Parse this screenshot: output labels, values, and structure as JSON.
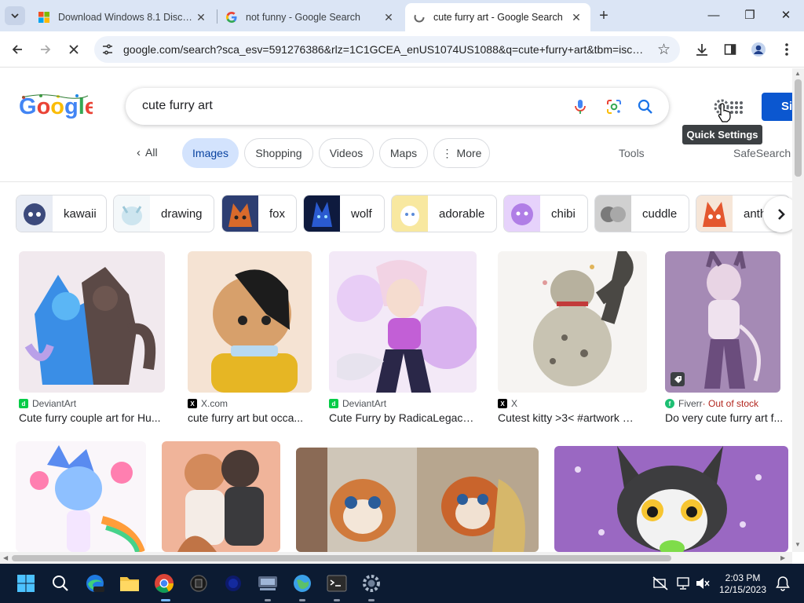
{
  "browser": {
    "tabs": [
      {
        "title": "Download Windows 8.1 Disc Im",
        "favicon": "windows-logo-icon"
      },
      {
        "title": "not funny - Google Search",
        "favicon": "google-g-icon"
      },
      {
        "title": "cute furry art - Google Search",
        "favicon": "loading-icon",
        "active": true
      }
    ],
    "url": "google.com/search?sca_esv=591276386&rlz=1C1GCEA_enUS1074US1088&q=cute+furry+art&tbm=isch&..."
  },
  "google": {
    "logo_text": "Google",
    "query": "cute furry art",
    "signin_label": "Si",
    "tooltip": "Quick Settings"
  },
  "nav": {
    "all": "All",
    "images": "Images",
    "shopping": "Shopping",
    "videos": "Videos",
    "maps": "Maps",
    "more": "More",
    "tools": "Tools",
    "safesearch": "SafeSearch"
  },
  "chips": [
    {
      "label": "kawaii",
      "color": "#4b5a8a"
    },
    {
      "label": "drawing",
      "color": "#cfe6ef"
    },
    {
      "label": "fox",
      "color": "#c8602a"
    },
    {
      "label": "wolf",
      "color": "#1f3b8c"
    },
    {
      "label": "adorable",
      "color": "#f2dc7a"
    },
    {
      "label": "chibi",
      "color": "#b388e0"
    },
    {
      "label": "cuddle",
      "color": "#9a9a9a"
    },
    {
      "label": "anth",
      "color": "#e4572e"
    }
  ],
  "results": [
    {
      "source": "DeviantArt",
      "caption": "Cute furry couple art for Hu...",
      "source_color": "#05cc47"
    },
    {
      "source": "X.com",
      "caption": "cute furry art but occa...",
      "source_color": "#000000"
    },
    {
      "source": "DeviantArt",
      "caption": "Cute Furry by RadicaLegacy...",
      "source_color": "#05cc47"
    },
    {
      "source": "X",
      "caption": "Cutest kitty >3< #artwork #...",
      "source_color": "#000000"
    },
    {
      "source": "Fiverr",
      "source_suffix": " · Out of stock",
      "caption": "Do very cute furry art f...",
      "source_color": "#1dbf73"
    }
  ],
  "taskbar": {
    "time": "2:03 PM",
    "date": "12/15/2023"
  }
}
